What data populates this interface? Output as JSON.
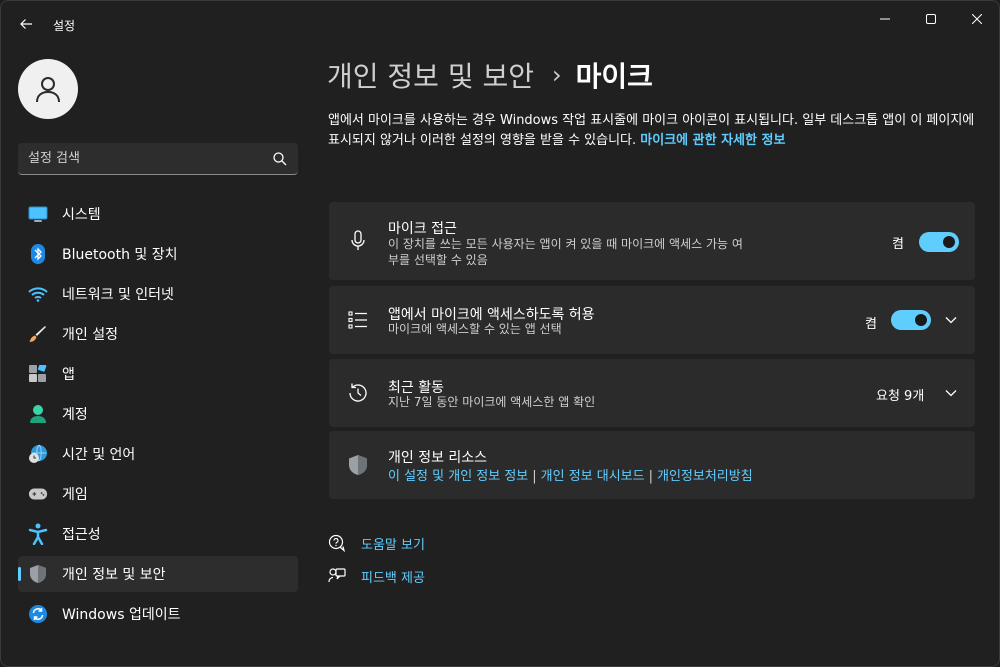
{
  "window": {
    "title": "설정"
  },
  "sidebar": {
    "search_placeholder": "설정 검색",
    "items": [
      {
        "label": "시스템",
        "icon": "monitor-icon",
        "active": false
      },
      {
        "label": "Bluetooth 및 장치",
        "icon": "bluetooth-icon",
        "active": false
      },
      {
        "label": "네트워크 및 인터넷",
        "icon": "wifi-icon",
        "active": false
      },
      {
        "label": "개인 설정",
        "icon": "paintbrush-icon",
        "active": false
      },
      {
        "label": "앱",
        "icon": "apps-icon",
        "active": false
      },
      {
        "label": "계정",
        "icon": "person-icon",
        "active": false
      },
      {
        "label": "시간 및 언어",
        "icon": "globe-clock-icon",
        "active": false
      },
      {
        "label": "게임",
        "icon": "gamepad-icon",
        "active": false
      },
      {
        "label": "접근성",
        "icon": "accessibility-icon",
        "active": false
      },
      {
        "label": "개인 정보 및 보안",
        "icon": "shield-icon",
        "active": true
      },
      {
        "label": "Windows 업데이트",
        "icon": "update-icon",
        "active": false
      }
    ]
  },
  "breadcrumb": {
    "parent": "개인 정보 및 보안",
    "separator": "›",
    "current": "마이크"
  },
  "description": {
    "text": "앱에서 마이크를 사용하는 경우 Windows 작업 표시줄에 마이크 아이콘이 표시됩니다. 일부 데스크톱 앱이 이 페이지에 표시되지 않거나 이러한 설정의 영향을 받을 수 있습니다. ",
    "link": "마이크에 관한 자세한 정보"
  },
  "cards": {
    "mic_access": {
      "title": "마이크 접근",
      "subtitle_line1": "이 장치를 쓰는 모든 사용자는 앱이 켜 있을 때 마이크에 액세스 가능 여",
      "subtitle_line2": "부를 선택할 수 있음",
      "state": "켬",
      "on": true
    },
    "app_access": {
      "title": "앱에서 마이크에 액세스하도록 허용",
      "subtitle": "마이크에 액세스할 수 있는 앱 선택",
      "state": "켬",
      "on": true
    },
    "recent": {
      "title": "최근 활동",
      "subtitle": "지난 7일 동안 마이크에 액세스한 앱 확인",
      "value": "요청 9개"
    },
    "resources": {
      "title": "개인 정보 리소스",
      "links": [
        "이 설정 및 개인 정보 정보",
        "개인 정보 대시보드",
        "개인정보처리방침"
      ],
      "separator": "|"
    }
  },
  "footer": {
    "help": "도움말 보기",
    "feedback": "피드백 제공"
  },
  "colors": {
    "accent": "#60cdff",
    "background": "#202020",
    "card": "#2b2b2b"
  }
}
